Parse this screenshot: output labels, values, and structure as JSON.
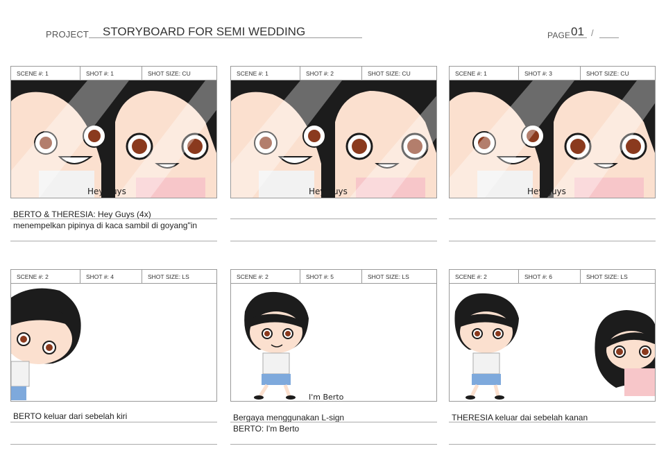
{
  "header": {
    "project_label": "PROJECT",
    "title": "STORYBOARD FOR SEMI WEDDING",
    "page_label": "PAGE",
    "page_number": "01",
    "page_sep": "/"
  },
  "panels": [
    {
      "scene": "SCENE #: 1",
      "shot": "SHOT #: 1",
      "size": "SHOT SIZE: CU",
      "frame_text": "Hey guys",
      "caption1": "BERTO & THERESIA: Hey Guys (4x)",
      "caption2": "menempelkan pipinya di kaca sambil di goyang\"in"
    },
    {
      "scene": "SCENE #: 1",
      "shot": "SHOT #: 2",
      "size": "SHOT SIZE: CU",
      "frame_text": "Hey guys",
      "caption1": "",
      "caption2": ""
    },
    {
      "scene": "SCENE #: 1",
      "shot": "SHOT #: 3",
      "size": "SHOT SIZE: CU",
      "frame_text": "Hey guys",
      "caption1": "",
      "caption2": ""
    },
    {
      "scene": "SCENE #: 2",
      "shot": "SHOT #: 4",
      "size": "SHOT SIZE: LS",
      "frame_text": "",
      "caption1": "BERTO keluar dari sebelah kiri",
      "caption2": ""
    },
    {
      "scene": "SCENE #: 2",
      "shot": "SHOT #: 5",
      "size": "SHOT SIZE: LS",
      "frame_text": "I'm Berto",
      "caption1": "Bergaya menggunakan L-sign",
      "caption2": "BERTO: I'm Berto"
    },
    {
      "scene": "SCENE #: 2",
      "shot": "SHOT #: 6",
      "size": "SHOT SIZE: LS",
      "frame_text": "",
      "caption1": "THERESIA keluar dai sebelah kanan",
      "caption2": ""
    }
  ],
  "colors": {
    "hair": "#1c1c1c",
    "skin": "#fbe0cf",
    "eye": "#8a3a1e",
    "shirt": "#f2f2f2",
    "shorts": "#7ea9dc",
    "dress": "#f7c6c9",
    "glass": "#dcdcdc"
  }
}
